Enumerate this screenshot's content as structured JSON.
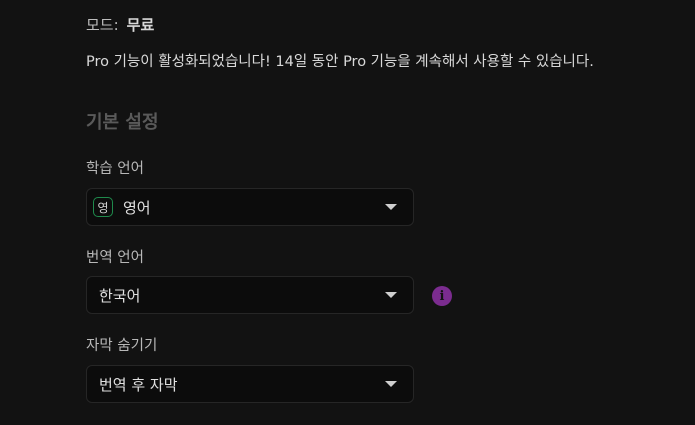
{
  "mode": {
    "label": "모드:",
    "value": "무료"
  },
  "pro_message": "Pro 기능이 활성화되었습니다! 14일 동안 Pro 기능을 계속해서 사용할 수 있습니다.",
  "section_title": "기본 설정",
  "learning_language": {
    "label": "학습 언어",
    "badge": "영",
    "value": "영어"
  },
  "translation_language": {
    "label": "번역 언어",
    "value": "한국어",
    "info_icon": "info-icon"
  },
  "hide_subtitles": {
    "label": "자막 숨기기",
    "value": "번역 후 자막"
  },
  "colors": {
    "accent_green": "#1f8a4c",
    "info_purple": "#7b2c8f",
    "background": "#121212"
  }
}
